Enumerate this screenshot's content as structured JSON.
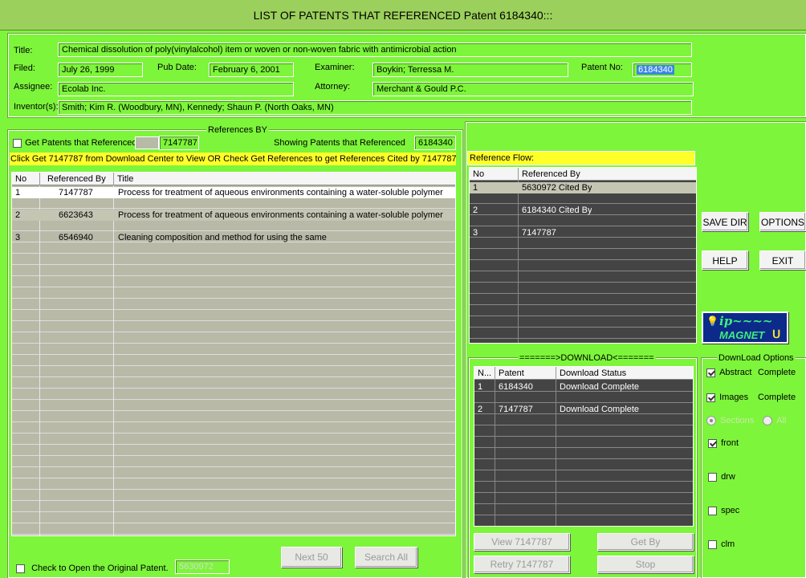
{
  "window": {
    "title": "LIST OF PATENTS THAT REFERENCED  Patent 6184340:::"
  },
  "info": {
    "title_label": "Title:",
    "title_value": "Chemical dissolution of poly(vinylalcohol) item or woven or non-woven    fabric with antimicrobial action",
    "filed_label": "Filed:",
    "filed_value": "July 26, 1999",
    "pub_label": "Pub Date:",
    "pub_value": "February 6, 2001",
    "examiner_label": "Examiner:",
    "examiner_value": "Boykin; Terressa M.",
    "patno_label": "Patent No:",
    "patno_value": "6184340",
    "assignee_label": "Assignee:",
    "assignee_value": "Ecolab Inc.",
    "attorney_label": "Attorney:",
    "attorney_value": "Merchant & Gould P.C.",
    "inventor_label": "Inventor(s):",
    "inventor_value": "Smith; Kim R. (Woodbury, MN), Kennedy; Shaun P. (North Oaks, MN)"
  },
  "refs": {
    "group_title": "References BY",
    "get_label": "Get Patents that Referenced",
    "get_value": "7147787",
    "showing_label": "Showing Patents that Referenced",
    "showing_value": "6184340",
    "hint": "Click Get 7147787 from Download Center to View OR Check Get References to get References Cited by 7147787",
    "columns": [
      "No",
      "Referenced By",
      "Title"
    ],
    "rows": [
      {
        "no": "1",
        "ref": "7147787",
        "title": "Process for treatment of aqueous environments containing a water-soluble polymer"
      },
      {
        "no": "2",
        "ref": "6623643",
        "title": "Process for treatment of aqueous environments containing a water-soluble polymer"
      },
      {
        "no": "3",
        "ref": "6546940",
        "title": "Cleaning composition and method for using the same"
      }
    ],
    "open_label": "Check to Open the Original Patent.",
    "open_value": "5630972",
    "next_label": "Next 50",
    "search_label": "Search All"
  },
  "flow": {
    "label": "Reference Flow:",
    "columns": [
      "No",
      "Referenced By"
    ],
    "rows": [
      {
        "no": "1",
        "ref": "5630972 Cited By"
      },
      {
        "no": "2",
        "ref": "6184340 Cited By"
      },
      {
        "no": "3",
        "ref": "7147787"
      }
    ]
  },
  "buttons": {
    "save_dir": "SAVE DIR",
    "options": "OPTIONS",
    "help": "HELP",
    "exit": "EXIT"
  },
  "logo": {
    "text": "ip~~~~",
    "sub": "MAGNET"
  },
  "download": {
    "group_title": "=======>DOWNLOAD<=======",
    "columns": [
      "N...",
      "Patent",
      "Download Status"
    ],
    "rows": [
      {
        "no": "1",
        "patent": "6184340",
        "status": "Download Complete"
      },
      {
        "no": "2",
        "patent": "7147787",
        "status": "Download Complete"
      }
    ],
    "view_label": "View 7147787",
    "getby_label": "Get By",
    "retry_label": "Retry 7147787",
    "stop_label": "Stop"
  },
  "options": {
    "group_title": "DownLoad Options",
    "abstract_label": "Abstract",
    "abstract_status": "Complete",
    "images_label": "Images",
    "images_status": "Complete",
    "sections_label": "Sections",
    "all_label": "All",
    "front_label": "front",
    "drw_label": "drw",
    "spec_label": "spec",
    "clm_label": "clm"
  }
}
